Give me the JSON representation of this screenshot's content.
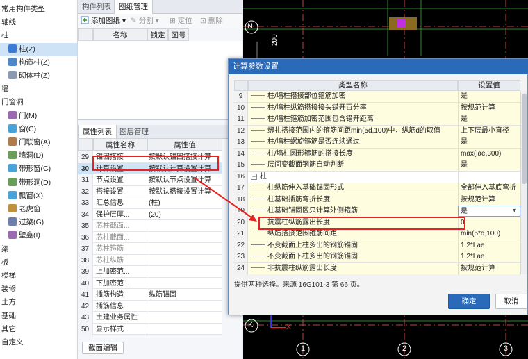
{
  "tree": {
    "items": [
      {
        "label": "常用构件类型",
        "indent": 0,
        "color": "",
        "sel": false
      },
      {
        "label": "轴线",
        "indent": 0,
        "color": "",
        "sel": false
      },
      {
        "label": "柱",
        "indent": 0,
        "color": "",
        "sel": false
      },
      {
        "label": "柱(Z)",
        "indent": 10,
        "color": "#3b7bd6",
        "sel": true
      },
      {
        "label": "构造柱(Z)",
        "indent": 10,
        "color": "#4f86c6",
        "sel": false
      },
      {
        "label": "砌体柱(Z)",
        "indent": 10,
        "color": "#8a9ab0",
        "sel": false
      },
      {
        "label": "墙",
        "indent": 0,
        "color": "",
        "sel": false
      },
      {
        "label": "门窗洞",
        "indent": 0,
        "color": "",
        "sel": false
      },
      {
        "label": "门(M)",
        "indent": 10,
        "color": "#9a6bb0",
        "sel": false
      },
      {
        "label": "窗(C)",
        "indent": 10,
        "color": "#4aa3d8",
        "sel": false
      },
      {
        "label": "门联窗(A)",
        "indent": 10,
        "color": "#b07a4a",
        "sel": false
      },
      {
        "label": "墙洞(D)",
        "indent": 10,
        "color": "#6a9c5a",
        "sel": false
      },
      {
        "label": "带形窗(C)",
        "indent": 10,
        "color": "#4aa3d8",
        "sel": false
      },
      {
        "label": "带形洞(D)",
        "indent": 10,
        "color": "#6a9c5a",
        "sel": false
      },
      {
        "label": "飘窗(X)",
        "indent": 10,
        "color": "#4aa3d8",
        "sel": false
      },
      {
        "label": "老虎窗",
        "indent": 10,
        "color": "#c0903a",
        "sel": false
      },
      {
        "label": "过梁(G)",
        "indent": 10,
        "color": "#6c7fa8",
        "sel": false
      },
      {
        "label": "壁龛(I)",
        "indent": 10,
        "color": "#9a6bb0",
        "sel": false
      },
      {
        "label": "梁",
        "indent": 0,
        "color": "",
        "sel": false
      },
      {
        "label": "板",
        "indent": 0,
        "color": "",
        "sel": false
      },
      {
        "label": "楼梯",
        "indent": 0,
        "color": "",
        "sel": false
      },
      {
        "label": "装修",
        "indent": 0,
        "color": "",
        "sel": false
      },
      {
        "label": "土方",
        "indent": 0,
        "color": "",
        "sel": false
      },
      {
        "label": "基础",
        "indent": 0,
        "color": "",
        "sel": false
      },
      {
        "label": "其它",
        "indent": 0,
        "color": "",
        "sel": false
      },
      {
        "label": "自定义",
        "indent": 0,
        "color": "",
        "sel": false
      }
    ]
  },
  "mid": {
    "top_tabs": [
      "构件列表",
      "图纸管理"
    ],
    "toolbar": {
      "add": "添加图纸",
      "split": "分割",
      "locate": "定位",
      "delete": "删除"
    },
    "drawing_cols": [
      "名称",
      "锁定",
      "图号"
    ],
    "prop_tabs": [
      "属性列表",
      "图层管理"
    ],
    "prop_cols": [
      "属性名称",
      "属性值"
    ],
    "rows": [
      {
        "n": "29",
        "name": "锚固搭接",
        "val": "按默认锚固搭接计算",
        "gray": false,
        "hl": false
      },
      {
        "n": "30",
        "name": "计算设置",
        "val": "按默认计算设置计算",
        "gray": false,
        "hl": true
      },
      {
        "n": "31",
        "name": "节点设置",
        "val": "按默认节点设置计算",
        "gray": false,
        "hl": false
      },
      {
        "n": "32",
        "name": "搭接设置",
        "val": "按默认搭接设置计算",
        "gray": false,
        "hl": false
      },
      {
        "n": "33",
        "name": "汇总信息",
        "val": "(柱)",
        "gray": false,
        "hl": false
      },
      {
        "n": "34",
        "name": "保护层厚...",
        "val": "(20)",
        "gray": false,
        "hl": false
      },
      {
        "n": "35",
        "name": "芯柱截面...",
        "val": "",
        "gray": true,
        "hl": false
      },
      {
        "n": "36",
        "name": "芯柱截面...",
        "val": "",
        "gray": true,
        "hl": false
      },
      {
        "n": "37",
        "name": "芯柱箍筋",
        "val": "",
        "gray": true,
        "hl": false
      },
      {
        "n": "38",
        "name": "芯柱纵筋",
        "val": "",
        "gray": true,
        "hl": false
      },
      {
        "n": "39",
        "name": "上加密范...",
        "val": "",
        "gray": false,
        "hl": false
      },
      {
        "n": "40",
        "name": "下加密范...",
        "val": "",
        "gray": false,
        "hl": false
      },
      {
        "n": "41",
        "name": "插筋构造",
        "val": "纵筋锚固",
        "gray": false,
        "hl": false
      },
      {
        "n": "42",
        "name": "插筋信息",
        "val": "",
        "gray": false,
        "hl": false
      },
      {
        "n": "43",
        "name": "土建业务属性",
        "val": "",
        "gray": false,
        "hl": false
      },
      {
        "n": "50",
        "name": "显示样式",
        "val": "",
        "gray": false,
        "hl": false
      }
    ],
    "section_edit_btn": "截面编辑"
  },
  "cad": {
    "axis_labels": [
      "N",
      "K",
      "1",
      "2",
      "3"
    ],
    "dim_text": "200"
  },
  "dialog": {
    "title": "计算参数设置",
    "col_name": "类型名称",
    "col_value": "设置值",
    "rows": [
      {
        "n": "9",
        "name": "柱/墙柱搭接部位箍筋加密",
        "val": "是",
        "sec": false
      },
      {
        "n": "10",
        "name": "柱/墙柱纵筋搭接接头错开百分率",
        "val": "按规范计算",
        "sec": false
      },
      {
        "n": "11",
        "name": "柱/墙柱箍筋加密范围包含错开距离",
        "val": "是",
        "sec": false
      },
      {
        "n": "12",
        "name": "绑扎搭接范围内的箍筋间距min(5d,100)中，纵筋d的取值",
        "val": "上下层最小直径",
        "sec": false
      },
      {
        "n": "13",
        "name": "柱/墙柱螺旋箍筋是否连续通过",
        "val": "是",
        "sec": false
      },
      {
        "n": "14",
        "name": "柱/墙柱圆形箍筋的搭接长度",
        "val": "max(lae,300)",
        "sec": false
      },
      {
        "n": "15",
        "name": "层间变截面钢筋自动判断",
        "val": "是",
        "sec": false
      },
      {
        "n": "16",
        "name": "柱",
        "val": "",
        "sec": true
      },
      {
        "n": "17",
        "name": "柱纵筋伸入基础锚固形式",
        "val": "全部伸入基底弯折",
        "sec": false
      },
      {
        "n": "18",
        "name": "柱基础插筋弯折长度",
        "val": "按规范计算",
        "sec": false
      },
      {
        "n": "19",
        "name": "柱基础锚固区只计算外侧箍筋",
        "val": "是",
        "sec": false
      },
      {
        "n": "20",
        "name": "抗震柱纵筋露出长度",
        "val": "0",
        "sec": false
      },
      {
        "n": "21",
        "name": "纵筋搭接范围箍筋间距",
        "val": "min(5*d,100)",
        "sec": false
      },
      {
        "n": "22",
        "name": "不变截面上柱多出的钢筋锚固",
        "val": "1.2*Lae",
        "sec": false
      },
      {
        "n": "23",
        "name": "不变截面下柱多出的钢筋锚固",
        "val": "1.2*Lae",
        "sec": false
      },
      {
        "n": "24",
        "name": "非抗震柱纵筋露出长度",
        "val": "按规范计算",
        "sec": false
      }
    ],
    "hint": "提供两种选择。来源 16G101-3 第 66 页。",
    "ok": "确定",
    "cancel": "取消"
  }
}
